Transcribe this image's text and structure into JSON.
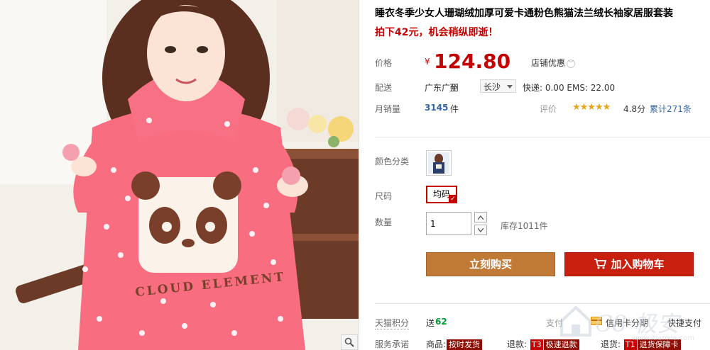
{
  "product": {
    "title": "睡衣冬季少女人珊瑚绒加厚可爱卡通粉色熊猫法兰绒长袖家居服套装",
    "subtitle": "拍下42元，机会稍纵即逝！",
    "image_text": "CLOUD ELEMENT"
  },
  "price": {
    "label": "价格",
    "currency": "¥",
    "value": "124.80",
    "shop_discount": "店铺优惠",
    "chevron_glyph": "﹀"
  },
  "shipping": {
    "label": "配送",
    "from": "广东广州",
    "to_word": "至",
    "city": "长沙",
    "fee": "快递: 0.00 EMS: 22.00"
  },
  "sales": {
    "label": "月销量",
    "count": "3145",
    "unit": "件",
    "rating_label": "评价",
    "stars": "★★★★★",
    "score": "4.8分",
    "reviews": "累计271条"
  },
  "sku": {
    "color_label": "颜色分类",
    "size_label": "尺码",
    "size_value": "均码",
    "tick": "✓",
    "qty_label": "数量",
    "qty_value": "1",
    "stock": "库存1011件"
  },
  "buttons": {
    "buy_now": "立刻购买",
    "add_cart": "加入购物车"
  },
  "points": {
    "label": "天猫积分",
    "send": "送",
    "amount": "62",
    "pay_label": "支付",
    "installment": "信用卡分期",
    "quickpay": "快捷支付"
  },
  "service": {
    "label": "服务承诺",
    "item1_prefix": "商品:",
    "item1_tag": "按时发货",
    "item2_prefix": "退款:",
    "item2_code": "T3",
    "item2_tag": "极速退款",
    "item3_prefix": "退货:",
    "item3_code": "T1",
    "item3_tag": "退货保障卡"
  },
  "watermark": {
    "text": "C8 极安",
    "url": "www.itianxia.com"
  },
  "colors": {
    "price_red": "#c40000",
    "buy_button": "#c17a36",
    "cart_button": "#c81f0e",
    "link_blue": "#3366aa",
    "points_green": "#009933"
  },
  "icons": [
    "zoom-icon",
    "chevron-down-icon",
    "cart-icon",
    "credit-card-icon",
    "star-icon",
    "check-icon"
  ]
}
